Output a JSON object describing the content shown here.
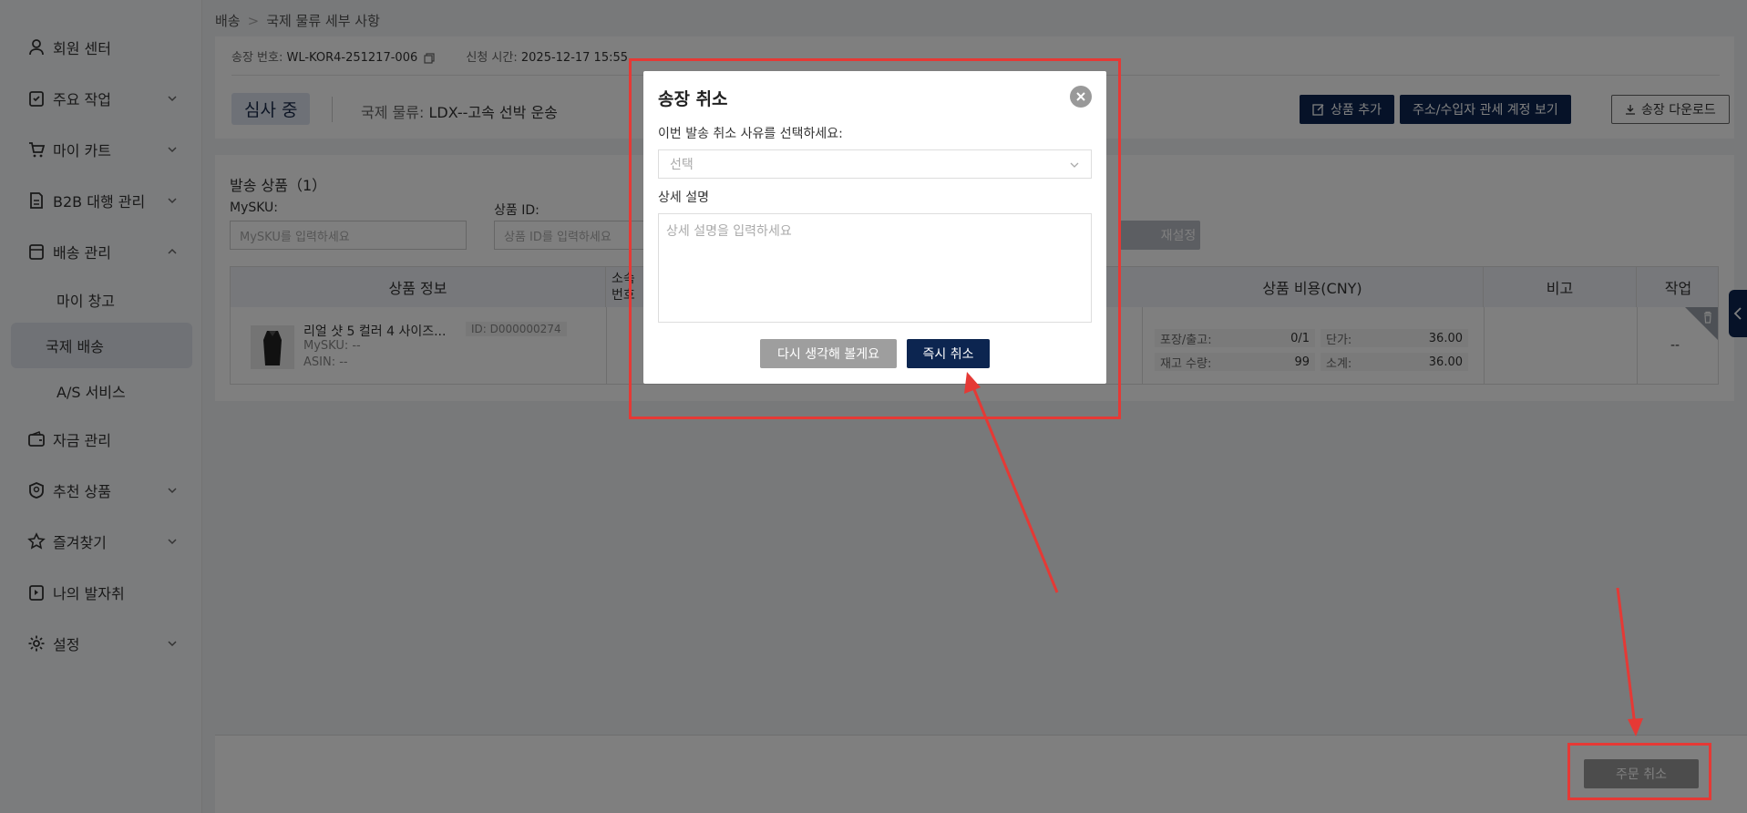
{
  "sidebar": {
    "items": [
      {
        "label": "회원 센터",
        "icon": "user-icon",
        "has_chevron": false
      },
      {
        "label": "주요 작업",
        "icon": "clipboard-icon",
        "has_chevron": true
      },
      {
        "label": "마이 카트",
        "icon": "cart-icon",
        "has_chevron": true
      },
      {
        "label": "B2B 대행 관리",
        "icon": "document-icon",
        "has_chevron": true
      },
      {
        "label": "배송 관리",
        "icon": "shipping-icon",
        "has_chevron": true,
        "expanded": true
      }
    ],
    "sub_items": [
      {
        "label": "마이 창고"
      },
      {
        "label": "국제 배송",
        "active": true
      },
      {
        "label": "A/S 서비스"
      }
    ],
    "items_after": [
      {
        "label": "자금 관리",
        "icon": "wallet-icon"
      },
      {
        "label": "추천 상품",
        "icon": "badge-icon"
      },
      {
        "label": "즐겨찾기",
        "icon": "star-icon"
      },
      {
        "label": "나의 발자취",
        "icon": "footprint-icon"
      },
      {
        "label": "설정",
        "icon": "gear-icon"
      }
    ]
  },
  "breadcrumb": {
    "root": "배송",
    "separator": ">",
    "current": "국제 물류 세부 사항"
  },
  "header": {
    "invoice_label": "송장 번호:",
    "invoice_value": "WL-KOR4-251217-006",
    "apply_time_label": "신청 시간:",
    "apply_time_value": "2025-12-17 15:55",
    "status": "심사 중",
    "route_label": "국제 물류:",
    "route_value": "LDX--고속 선박 운송",
    "buttons": {
      "add_product": "상품 추가",
      "view_customs": "주소/수입자 관세 계정 보기",
      "download_invoice": "송장 다운로드"
    }
  },
  "goods": {
    "title": "발송 상품（1）",
    "filters": {
      "mysku_label": "MySKU:",
      "mysku_placeholder": "MySKU를 입력하세요",
      "product_id_label": "상품 ID:",
      "product_id_placeholder": "상품 ID를 입력하세요",
      "reset_label": "재설정"
    },
    "columns": [
      "상품 정보",
      "소속\n번호",
      "상품 비용(CNY)",
      "비고",
      "작업"
    ],
    "rows": [
      {
        "name": "리얼 샷 5 컬러 4 사이즈...",
        "id": "ID: D000000274",
        "mysku": "MySKU: --",
        "asin": "ASIN: --",
        "pack_label": "포장/출고:",
        "pack_value": "0/1",
        "stock_label": "재고 수량:",
        "stock_value": "99",
        "unit_label": "단가:",
        "unit_value": "36.00",
        "subtotal_label": "소계:",
        "subtotal_value": "36.00",
        "action": "--"
      }
    ]
  },
  "footer": {
    "cancel_order": "주문 취소"
  },
  "modal": {
    "title": "송장 취소",
    "reason_label": "이번 발송 취소 사유를 선택하세요:",
    "reason_placeholder": "선택",
    "detail_label": "상세 설명",
    "detail_placeholder": "상세 설명을 입력하세요",
    "rethink_button": "다시 생각해 볼게요",
    "confirm_button": "즉시 취소"
  },
  "colors": {
    "brand_navy": "#0c2550",
    "annotation_red": "#e53935",
    "overlay": "rgba(0,0,0,0.5)"
  }
}
